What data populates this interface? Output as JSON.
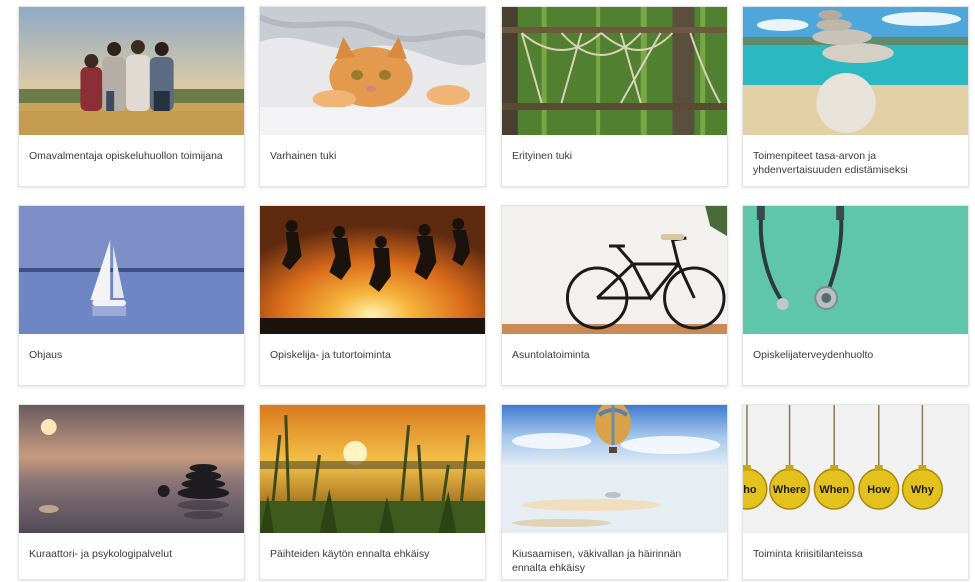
{
  "cards": [
    {
      "label": "Omavalmentaja opiskeluhuollon toimijana",
      "image": "family-in-field-photo"
    },
    {
      "label": "Varhainen tuki",
      "image": "kitten-under-blanket-photo"
    },
    {
      "label": "Erityinen tuki",
      "image": "rope-course-forest-photo"
    },
    {
      "label": "Toimenpiteet tasa-arvon ja yhdenvertaisuuden edistämiseksi",
      "image": "balanced-stones-beach-photo"
    },
    {
      "label": "Ohjaus",
      "image": "sailboat-lake-photo"
    },
    {
      "label": "Opiskelija- ja tutortoiminta",
      "image": "jumping-people-sunset-photo"
    },
    {
      "label": "Asuntolatoiminta",
      "image": "bicycle-against-wall-photo"
    },
    {
      "label": "Opiskelijaterveydenhuolto",
      "image": "stethoscope-photo"
    },
    {
      "label": "Kuraattori- ja psykologipalvelut",
      "image": "zen-stones-sunset-photo"
    },
    {
      "label": "Päihteiden käytön ennalta ehkäisy",
      "image": "reeds-sunset-photo"
    },
    {
      "label": "Kiusaamisen, väkivallan ja häirinnän ennalta ehkäisy",
      "image": "hot-air-balloon-photo"
    },
    {
      "label": "Toiminta kriisitilanteissa",
      "image": "question-word-ornaments-photo",
      "ornament_words": [
        "ho",
        "Where",
        "When",
        "How",
        "Why"
      ]
    }
  ]
}
